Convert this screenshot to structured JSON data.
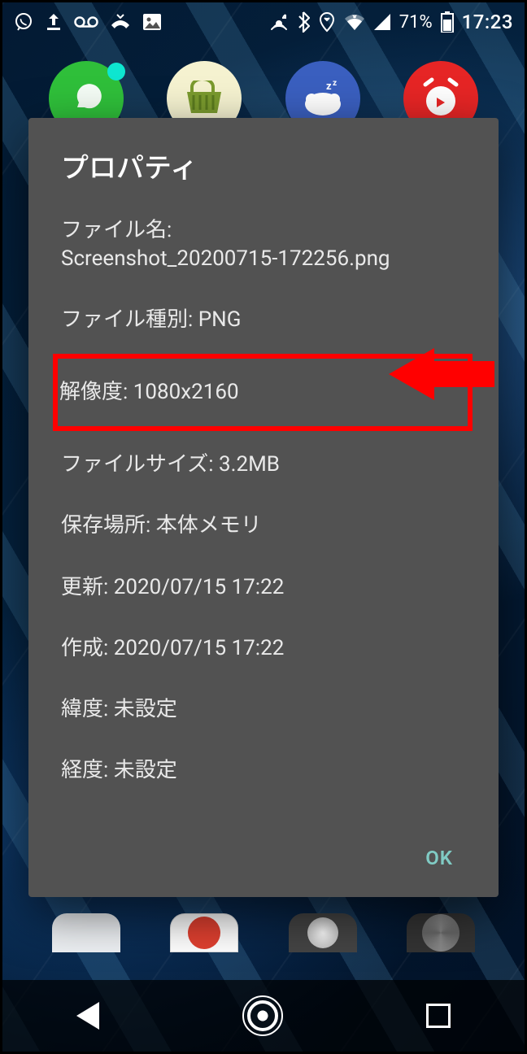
{
  "statusbar": {
    "battery_pct": "71%",
    "time": "17:23"
  },
  "dialog": {
    "title": "プロパティ",
    "filename_label": "ファイル名:",
    "filename_value": "Screenshot_20200715-172256.png",
    "filetype_label": "ファイル種別:",
    "filetype_value": "PNG",
    "resolution_label": "解像度:",
    "resolution_value": "1080x2160",
    "filesize_label": "ファイルサイズ:",
    "filesize_value": "3.2MB",
    "location_label": "保存場所:",
    "location_value": "本体メモリ",
    "updated_label": "更新:",
    "updated_value": "2020/07/15 17:22",
    "created_label": "作成:",
    "created_value": "2020/07/15 17:22",
    "latitude_label": "緯度:",
    "latitude_value": "未設定",
    "longitude_label": "経度:",
    "longitude_value": "未設定",
    "ok_label": "OK"
  }
}
